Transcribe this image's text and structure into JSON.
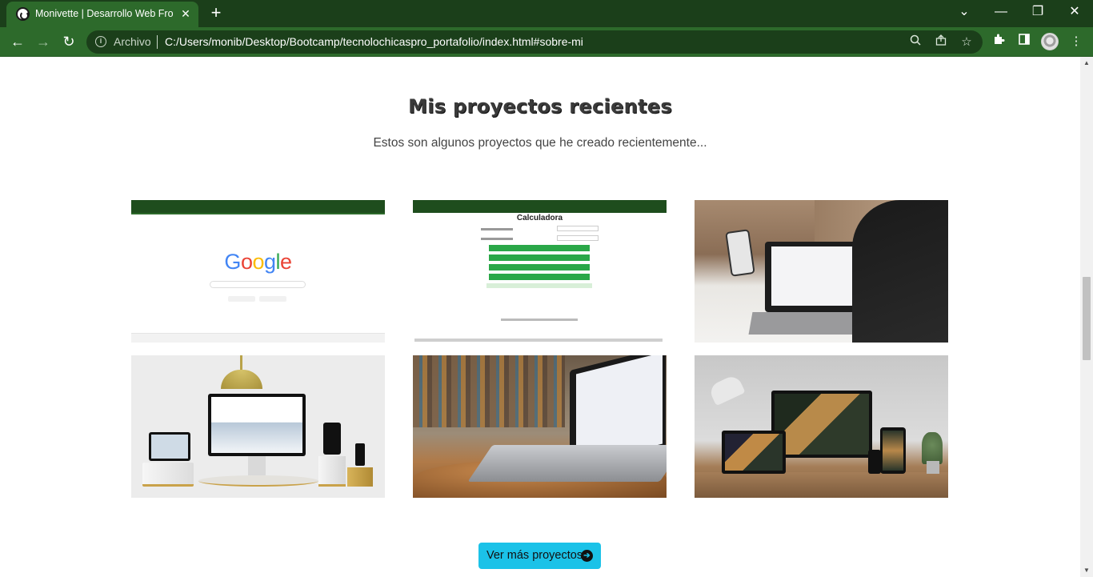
{
  "browser": {
    "tab_title": "Monivette | Desarrollo Web Front",
    "tab_close": "✕",
    "new_tab": "+",
    "window_controls": {
      "dropdown": "⌄",
      "minimize": "—",
      "restore": "❐",
      "close": "✕"
    },
    "back": "←",
    "forward": "→",
    "reload": "↻",
    "scheme": "Archivo",
    "url": "C:/Users/monib/Desktop/Bootcamp/tecnolochicaspro_portafolio/index.html#sobre-mi",
    "toolbar_icons": [
      "zoom-icon",
      "share-icon",
      "star-icon",
      "extensions-icon",
      "side-panel-icon",
      "profile-avatar",
      "menu-icon"
    ]
  },
  "section": {
    "title": "Mis proyectos recientes",
    "subtitle": "Estos son algunos proyectos que he creado recientemente..."
  },
  "projects": {
    "google_logo": "Google",
    "calculator_title": "Calculadora"
  },
  "more_button": {
    "label": "Ver más proyectos",
    "icon": "➔"
  },
  "colors": {
    "chrome_dark": "#1b3f1a",
    "chrome_toolbar": "#2d6a2b",
    "accent_button": "#1bc2e8"
  }
}
